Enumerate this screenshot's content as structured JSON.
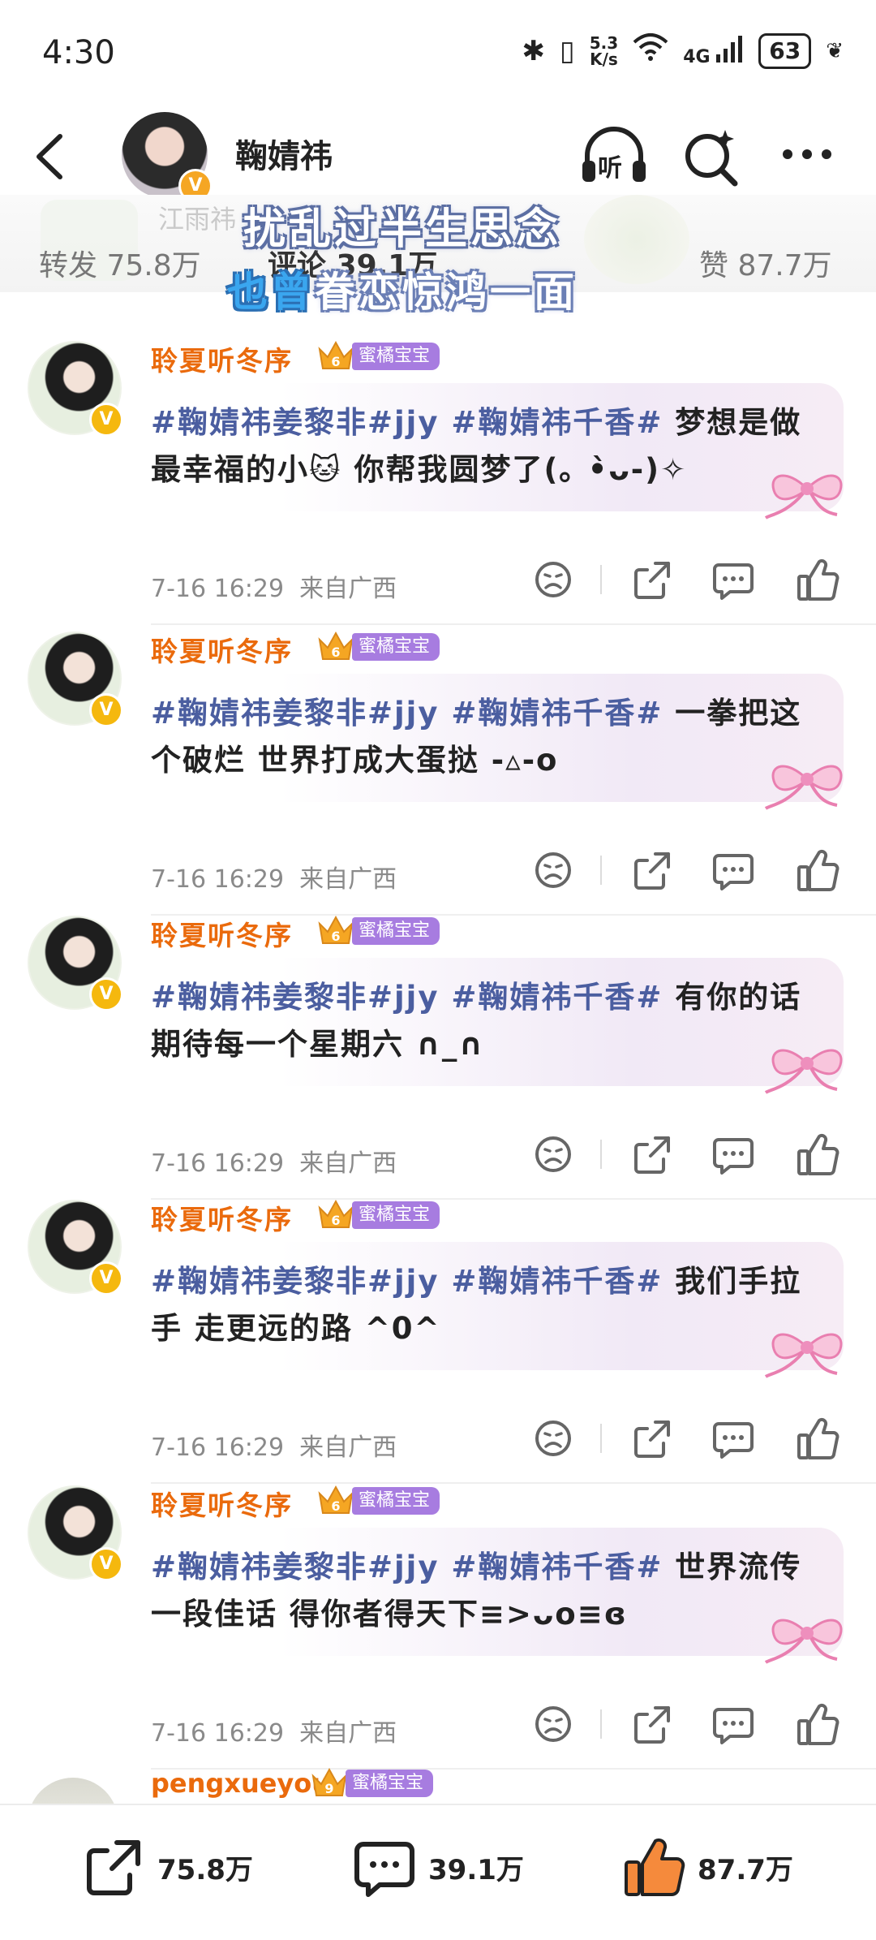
{
  "status_bar": {
    "time": "4:30",
    "net_speed_value": "5.3",
    "net_speed_unit": "K/s",
    "network": "4G",
    "battery": "63"
  },
  "header": {
    "username": "鞠婧祎",
    "listen_label": "听"
  },
  "stats": {
    "faded_name": "江雨祎",
    "repost": "转发 75.8万",
    "comment": "评论 39.1万",
    "like": "赞 87.7万"
  },
  "overlay": {
    "line1": "扰乱过半生思念",
    "line2_blue": "也曾",
    "line2_rest": "眷恋惊鸿一面"
  },
  "comments": [
    {
      "username": "聆夏听冬序",
      "level": "6",
      "badge": "蜜橘宝宝",
      "tags": "#鞠婧祎姜黎非#jjy #鞠婧祎千香# ",
      "text": "梦想是做最幸福的小🐱 你帮我圆梦了(｡ •̀ᴗ-)✧",
      "time": "7-16 16:29",
      "location": "来自广西"
    },
    {
      "username": "聆夏听冬序",
      "level": "6",
      "badge": "蜜橘宝宝",
      "tags": "#鞠婧祎姜黎非#jjy #鞠婧祎千香# ",
      "text": "一拳把这个破烂 世界打成大蛋挞 -▵-ο",
      "time": "7-16 16:29",
      "location": "来自广西"
    },
    {
      "username": "聆夏听冬序",
      "level": "6",
      "badge": "蜜橘宝宝",
      "tags": "#鞠婧祎姜黎非#jjy #鞠婧祎千香# ",
      "text": "有你的话 期待每一个星期六 ∩_∩",
      "time": "7-16 16:29",
      "location": "来自广西"
    },
    {
      "username": "聆夏听冬序",
      "level": "6",
      "badge": "蜜橘宝宝",
      "tags": "#鞠婧祎姜黎非#jjy #鞠婧祎千香# ",
      "text": "我们手拉手 走更远的路 ^0^",
      "time": "7-16 16:29",
      "location": "来自广西"
    },
    {
      "username": "聆夏听冬序",
      "level": "6",
      "badge": "蜜橘宝宝",
      "tags": "#鞠婧祎姜黎非#jjy #鞠婧祎千香# ",
      "text": "世界流传一段佳话 得你者得天下≡>ᴗο≡ɞ",
      "time": "7-16 16:29",
      "location": "来自广西"
    }
  ],
  "partial_comment": {
    "username": "pengxueyou",
    "level": "9",
    "badge": "蜜橘宝宝"
  },
  "bottom_bar": {
    "repost": "75.8万",
    "comment": "39.1万",
    "like": "87.7万"
  },
  "colors": {
    "username": "#ea6a0c",
    "hashtag": "#4b5ea0",
    "badge": "#a77ce0",
    "like_orange": "#f58a3c",
    "vbadge": "#f5b80e"
  },
  "icons": [
    "back-arrow-icon",
    "headphones-icon",
    "search-icon",
    "more-dots-icon",
    "dislike-face-icon",
    "share-icon",
    "comment-icon",
    "like-thumb-icon",
    "crown-icon",
    "bow-icon"
  ]
}
